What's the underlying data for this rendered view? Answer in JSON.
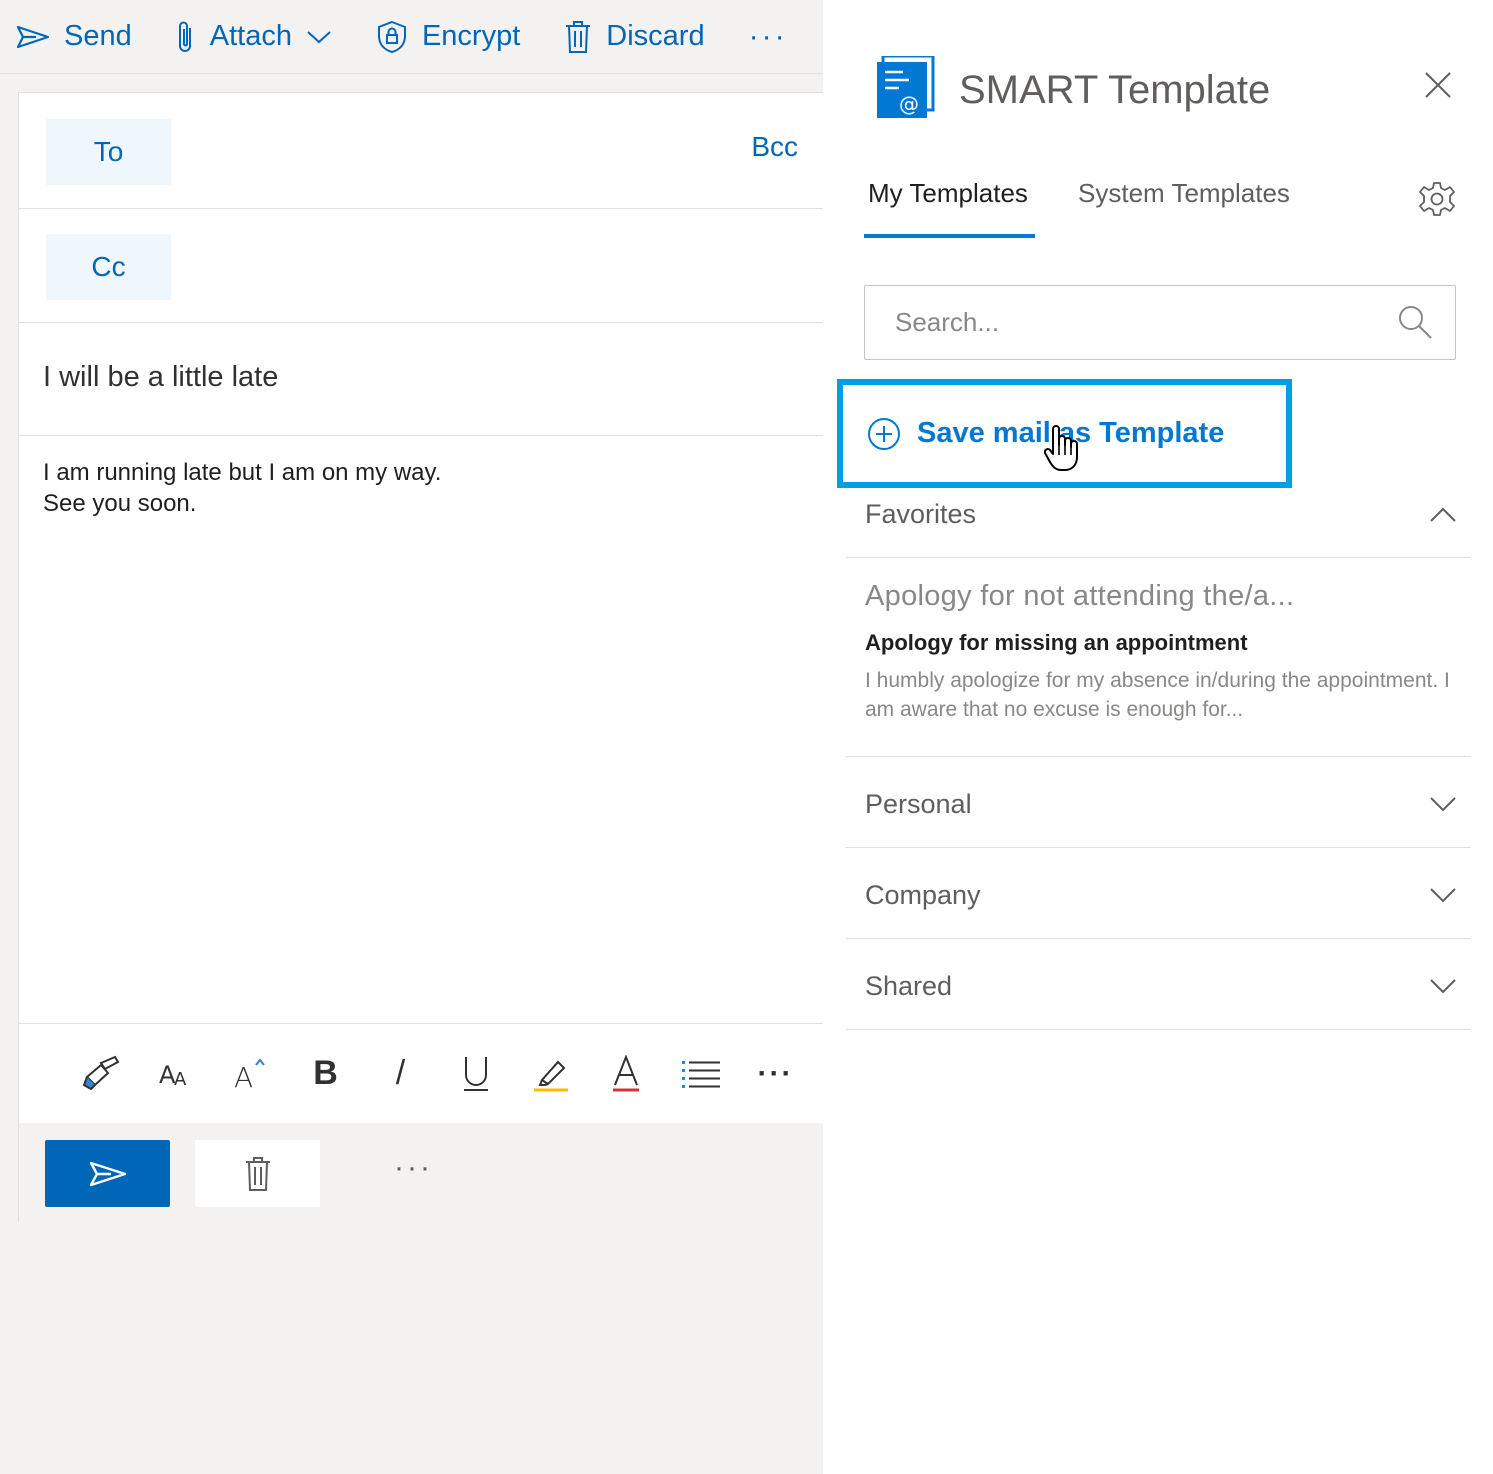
{
  "toolbar": {
    "send_label": "Send",
    "attach_label": "Attach",
    "encrypt_label": "Encrypt",
    "discard_label": "Discard",
    "more_label": "···"
  },
  "compose": {
    "to_label": "To",
    "cc_label": "Cc",
    "bcc_label": "Bcc",
    "subject": "I will be a little late",
    "body_lines": [
      "I am running late but I am on my way.",
      "See you soon."
    ],
    "more_label": "···",
    "accent_color": "#0067b8"
  },
  "format_bar": {
    "buttons": [
      "format-painter-icon",
      "font-size-icon",
      "font-grow-icon",
      "bold-icon",
      "italic-icon",
      "underline-icon",
      "highlight-icon",
      "font-color-icon",
      "bullets-icon",
      "more-icon"
    ],
    "bold_glyph": "B",
    "italic_glyph": "/",
    "underline_glyph": "U",
    "more_label": "···"
  },
  "addin": {
    "title": "SMART Template",
    "tabs": [
      {
        "label": "My Templates",
        "active": true
      },
      {
        "label": "System Templates",
        "active": false
      }
    ],
    "search_placeholder": "Search...",
    "save_label": "Save mail as Template",
    "sections": {
      "favorites": {
        "label": "Favorites",
        "expanded": true,
        "subtitle": "Apology for not attending the/a...",
        "item_title": "Apology for missing an appointment",
        "item_desc": "I humbly apologize for my absence in/during the appointment. I am aware that no excuse is enough for..."
      },
      "personal": {
        "label": "Personal",
        "expanded": false
      },
      "company": {
        "label": "Company",
        "expanded": false
      },
      "shared": {
        "label": "Shared",
        "expanded": false
      }
    },
    "accent_color": "#0078d4",
    "highlight_color": "#009fe3"
  }
}
